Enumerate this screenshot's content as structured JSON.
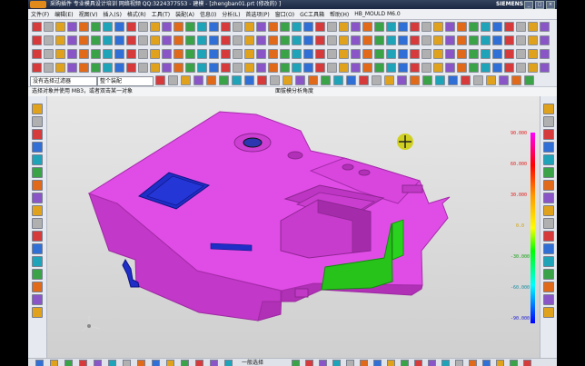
{
  "window": {
    "title": "采购插件  专业模具设计培训  网络视频  QQ:3224377553 - 建模 - [zhengban01.prt (修改的) ]",
    "brand": "SIEMENS",
    "controls": [
      "_",
      "□",
      "×"
    ]
  },
  "menu": {
    "items": [
      "文件(F)",
      "编辑(E)",
      "视图(V)",
      "插入(S)",
      "格式(R)",
      "工具(T)",
      "装配(A)",
      "信息(I)",
      "分析(L)",
      "首选项(P)",
      "窗口(O)",
      "GC工具箱",
      "帮助(H)",
      "HB_MOULD M6.0"
    ]
  },
  "toolbar": {
    "sel_filter": "没有选择过滤器",
    "sel_scope": "整个装配"
  },
  "status": {
    "left": "选择对象并使用 MB3，或者双击某一对象",
    "right": "面拔模分析角度"
  },
  "legend": {
    "labels": [
      "-90.000",
      "-60.000",
      "-30.000",
      "0.0",
      "30.000",
      "60.000",
      "90.000"
    ],
    "colors_top_to_bottom": [
      "#ff00ff",
      "#ff0000",
      "#ff9900",
      "#ffff00",
      "#00ff00",
      "#00ffff",
      "#0000ff"
    ]
  },
  "bottom": {
    "label": "一般选择"
  },
  "colors": {
    "part_top": "#e04de6",
    "part_side": "#c238c8",
    "part_dark": "#9d2aa2",
    "green": "#27c31b",
    "blue": "#1f2ec7"
  }
}
